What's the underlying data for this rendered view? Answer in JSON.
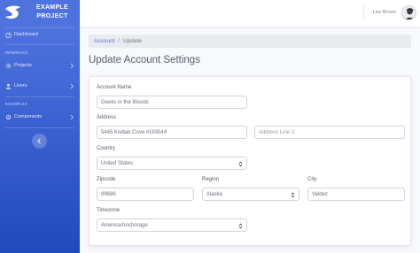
{
  "brand": {
    "line1": "EXAMPLE",
    "line2": "PROJECT"
  },
  "sidebar": {
    "dashboard": "Dashboard",
    "heading_interface": "INTERFACE",
    "projects": "Projects",
    "users": "Users",
    "heading_examples": "EXAMPLES",
    "components": "Components"
  },
  "topbar": {
    "user_name": "Lee Brown"
  },
  "breadcrumb": {
    "link": "Account",
    "separator": "/",
    "current": "Update"
  },
  "page": {
    "title": "Update Account Settings"
  },
  "form": {
    "account_name": {
      "label": "Account Name",
      "value": "Geeks in the Woods"
    },
    "address": {
      "label": "Address",
      "line1": "5445 Kodiak Cove #193544",
      "line2_placeholder": "Address Line 2"
    },
    "country": {
      "label": "Country",
      "value": "United States"
    },
    "zipcode": {
      "label": "Zipcode",
      "value": "99686"
    },
    "region": {
      "label": "Region",
      "value": "Alaska"
    },
    "city": {
      "label": "City",
      "value": "Valdez"
    },
    "timezone": {
      "label": "Timezone",
      "value": "America/Anchorage"
    }
  },
  "colors": {
    "sidebar_start": "#4e73df",
    "sidebar_end": "#224abe",
    "link": "#4e73df",
    "background": "#f8f9fc"
  },
  "icons": [
    "logo-icon",
    "dashboard-icon",
    "projects-icon",
    "users-icon",
    "components-icon",
    "chevron-right-icon",
    "chevron-left-icon",
    "select-caret-icon"
  ]
}
